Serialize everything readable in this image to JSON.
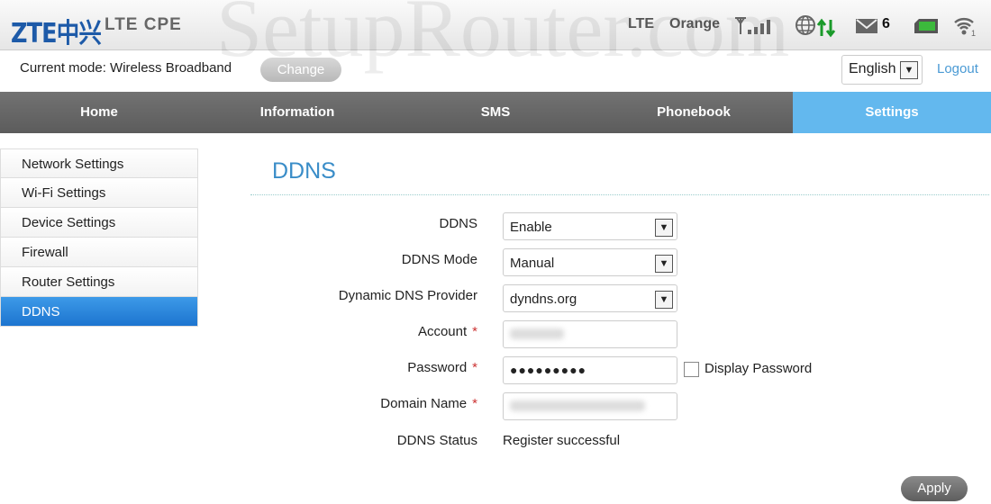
{
  "header": {
    "logo": "ZTE中兴",
    "product": "LTE CPE",
    "watermark": "SetupRouter.com",
    "network_type": "LTE",
    "carrier": "Orange",
    "sms_count": "6",
    "wifi_clients": "1",
    "signal_level": "4/4"
  },
  "mode": {
    "label": "Current mode: Wireless Broadband",
    "change": "Change"
  },
  "language": "English",
  "logout": "Logout",
  "nav": [
    "Home",
    "Information",
    "SMS",
    "Phonebook",
    "Settings"
  ],
  "sidebar": [
    "Network Settings",
    "Wi-Fi Settings",
    "Device Settings",
    "Firewall",
    "Router Settings",
    "DDNS"
  ],
  "page_title": "DDNS",
  "form": {
    "ddns": {
      "label": "DDNS",
      "value": "Enable"
    },
    "mode": {
      "label": "DDNS Mode",
      "value": "Manual"
    },
    "provider": {
      "label": "Dynamic DNS Provider",
      "value": "dyndns.org"
    },
    "account": {
      "label": "Account",
      "req": "*"
    },
    "password": {
      "label": "Password",
      "req": "*",
      "value": "●●●●●●●●●",
      "display": "Display Password"
    },
    "domain": {
      "label": "Domain Name",
      "req": "*"
    },
    "status": {
      "label": "DDNS Status",
      "value": "Register successful"
    }
  },
  "apply": "Apply",
  "colors": {
    "accent": "#63b8ee",
    "sidebar_active": "#1d74cf",
    "title": "#3a8dc8"
  }
}
